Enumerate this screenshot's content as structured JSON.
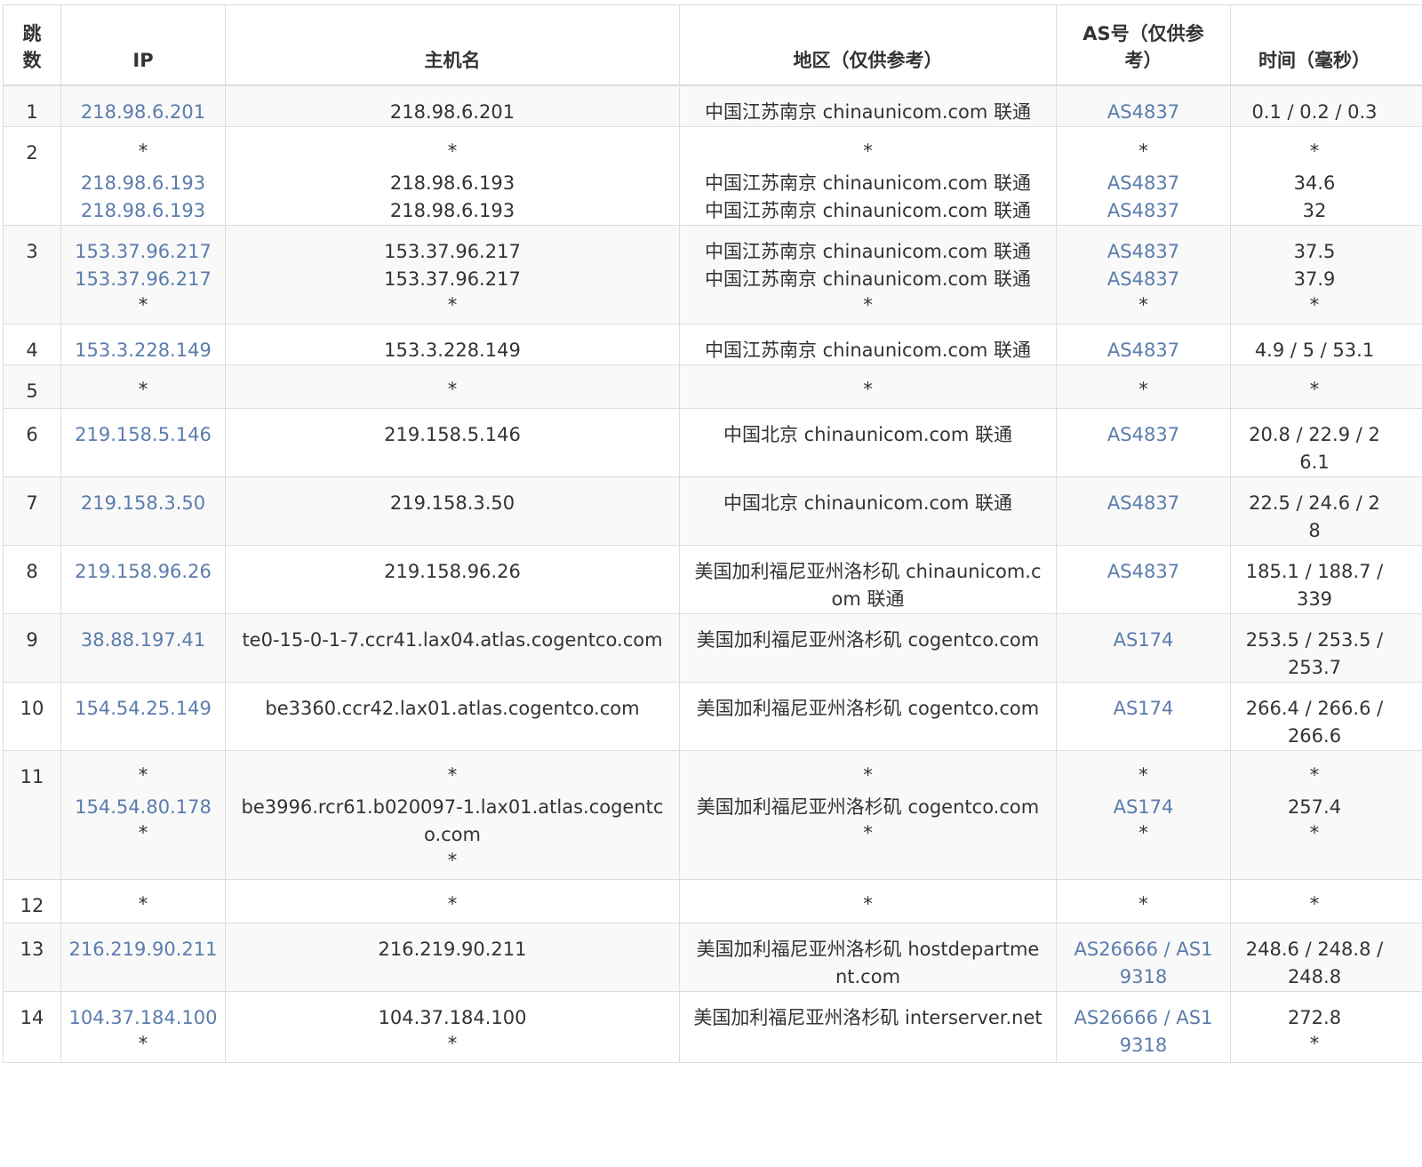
{
  "table": {
    "headers": {
      "hop": "跳数",
      "ip": "IP",
      "host": "主机名",
      "location": "地区（仅供参考）",
      "as": "AS号（仅供参考）",
      "time": "时间（毫秒）"
    },
    "rows": [
      {
        "hop": "1",
        "ip": [
          "218.98.6.201"
        ],
        "host": [
          "218.98.6.201"
        ],
        "location": [
          "中国江苏南京 chinaunicom.com 联通"
        ],
        "as": [
          "AS4837"
        ],
        "time": [
          "0.1 / 0.2 / 0.3"
        ]
      },
      {
        "hop": "2",
        "ip": [
          "*",
          "218.98.6.193",
          "218.98.6.193"
        ],
        "host": [
          "*",
          "218.98.6.193",
          "218.98.6.193"
        ],
        "location": [
          "*",
          "中国江苏南京 chinaunicom.com 联通",
          "中国江苏南京 chinaunicom.com 联通"
        ],
        "as": [
          "*",
          "AS4837",
          "AS4837"
        ],
        "time": [
          "*",
          "34.6",
          "32"
        ]
      },
      {
        "hop": "3",
        "ip": [
          "153.37.96.217",
          "153.37.96.217",
          "*"
        ],
        "host": [
          "153.37.96.217",
          "153.37.96.217",
          "*"
        ],
        "location": [
          "中国江苏南京 chinaunicom.com 联通",
          "中国江苏南京 chinaunicom.com 联通",
          "*"
        ],
        "as": [
          "AS4837",
          "AS4837",
          "*"
        ],
        "time": [
          "37.5",
          "37.9",
          "*"
        ]
      },
      {
        "hop": "4",
        "ip": [
          "153.3.228.149"
        ],
        "host": [
          "153.3.228.149"
        ],
        "location": [
          "中国江苏南京 chinaunicom.com 联通"
        ],
        "as": [
          "AS4837"
        ],
        "time": [
          "4.9 / 5 / 53.1"
        ]
      },
      {
        "hop": "5",
        "ip": [
          "*"
        ],
        "host": [
          "*"
        ],
        "location": [
          "*"
        ],
        "as": [
          "*"
        ],
        "time": [
          "*"
        ]
      },
      {
        "hop": "6",
        "ip": [
          "219.158.5.146"
        ],
        "host": [
          "219.158.5.146"
        ],
        "location": [
          "中国北京 chinaunicom.com 联通"
        ],
        "as": [
          "AS4837"
        ],
        "time": [
          "20.8 / 22.9 / 26.1"
        ]
      },
      {
        "hop": "7",
        "ip": [
          "219.158.3.50"
        ],
        "host": [
          "219.158.3.50"
        ],
        "location": [
          "中国北京 chinaunicom.com 联通"
        ],
        "as": [
          "AS4837"
        ],
        "time": [
          "22.5 / 24.6 / 28"
        ]
      },
      {
        "hop": "8",
        "ip": [
          "219.158.96.26"
        ],
        "host": [
          "219.158.96.26"
        ],
        "location": [
          "美国加利福尼亚州洛杉矶 chinaunicom.com 联通"
        ],
        "as": [
          "AS4837"
        ],
        "time": [
          "185.1 / 188.7 / 339"
        ]
      },
      {
        "hop": "9",
        "ip": [
          "38.88.197.41"
        ],
        "host": [
          "te0-15-0-1-7.ccr41.lax04.atlas.cogentco.com"
        ],
        "location": [
          "美国加利福尼亚州洛杉矶 cogentco.com"
        ],
        "as": [
          "AS174"
        ],
        "time": [
          "253.5 / 253.5 / 253.7"
        ]
      },
      {
        "hop": "10",
        "ip": [
          "154.54.25.149"
        ],
        "host": [
          "be3360.ccr42.lax01.atlas.cogentco.com"
        ],
        "location": [
          "美国加利福尼亚州洛杉矶 cogentco.com"
        ],
        "as": [
          "AS174"
        ],
        "time": [
          "266.4 / 266.6 / 266.6"
        ]
      },
      {
        "hop": "11",
        "ip": [
          "*",
          "154.54.80.178",
          "*"
        ],
        "host": [
          "*",
          "be3996.rcr61.b020097-1.lax01.atlas.cogentco.com",
          "*"
        ],
        "location": [
          "*",
          "美国加利福尼亚州洛杉矶 cogentco.com",
          "*"
        ],
        "as": [
          "*",
          "AS174",
          "*"
        ],
        "time": [
          "*",
          "257.4",
          "*"
        ]
      },
      {
        "hop": "12",
        "ip": [
          "*"
        ],
        "host": [
          "*"
        ],
        "location": [
          "*"
        ],
        "as": [
          "*"
        ],
        "time": [
          "*"
        ]
      },
      {
        "hop": "13",
        "ip": [
          "216.219.90.211"
        ],
        "host": [
          "216.219.90.211"
        ],
        "location": [
          "美国加利福尼亚州洛杉矶 hostdepartment.com"
        ],
        "as": [
          "AS26666 / AS19318"
        ],
        "time": [
          "248.6 / 248.8 / 248.8"
        ]
      },
      {
        "hop": "14",
        "ip": [
          "104.37.184.100",
          "*"
        ],
        "host": [
          "104.37.184.100",
          "*"
        ],
        "location": [
          "美国加利福尼亚州洛杉矶 interserver.net"
        ],
        "as": [
          "AS26666 / AS19318"
        ],
        "time": [
          "272.8",
          "*"
        ]
      }
    ]
  },
  "colors": {
    "link": "#5b7cac",
    "text": "#333333",
    "border": "#dddddd",
    "stripe": "#f9f9f9"
  }
}
